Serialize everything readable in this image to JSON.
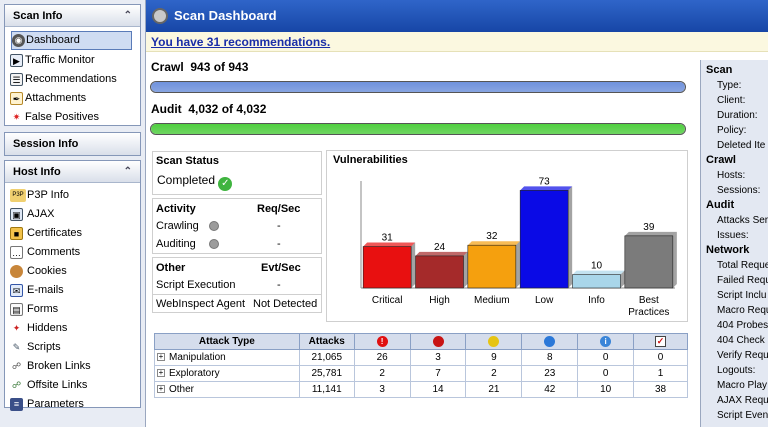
{
  "sidebar": {
    "scan_info": {
      "title": "Scan Info",
      "items": [
        {
          "label": "Dashboard",
          "icon": "dashboard-icon"
        },
        {
          "label": "Traffic Monitor",
          "icon": "traffic-monitor-icon"
        },
        {
          "label": "Recommendations",
          "icon": "recommendations-icon"
        },
        {
          "label": "Attachments",
          "icon": "attachments-icon"
        },
        {
          "label": "False Positives",
          "icon": "false-positives-icon"
        }
      ]
    },
    "session_info": {
      "title": "Session Info"
    },
    "host_info": {
      "title": "Host Info",
      "items": [
        {
          "label": "P3P Info",
          "icon": "p3p-icon"
        },
        {
          "label": "AJAX",
          "icon": "ajax-icon"
        },
        {
          "label": "Certificates",
          "icon": "certificates-icon"
        },
        {
          "label": "Comments",
          "icon": "comments-icon"
        },
        {
          "label": "Cookies",
          "icon": "cookies-icon"
        },
        {
          "label": "E-mails",
          "icon": "emails-icon"
        },
        {
          "label": "Forms",
          "icon": "forms-icon"
        },
        {
          "label": "Hiddens",
          "icon": "hiddens-icon"
        },
        {
          "label": "Scripts",
          "icon": "scripts-icon"
        },
        {
          "label": "Broken Links",
          "icon": "broken-links-icon"
        },
        {
          "label": "Offsite Links",
          "icon": "offsite-links-icon"
        },
        {
          "label": "Parameters",
          "icon": "parameters-icon"
        }
      ]
    }
  },
  "main": {
    "title": "Scan Dashboard",
    "recommendations": "You have 31 recommendations.",
    "crawl": {
      "label": "Crawl",
      "value": "943 of 943",
      "progress": 1.0,
      "color": "#6f92dd"
    },
    "audit": {
      "label": "Audit",
      "value": "4,032 of 4,032",
      "progress": 1.0,
      "color": "#4fcf3f"
    },
    "scan_status": {
      "title": "Scan Status",
      "value": "Completed"
    },
    "activity": {
      "title": "Activity",
      "unit": "Req/Sec",
      "rows": [
        {
          "label": "Crawling",
          "value": "-"
        },
        {
          "label": "Auditing",
          "value": "-"
        }
      ]
    },
    "other": {
      "title": "Other",
      "unit": "Evt/Sec",
      "rows": [
        {
          "label": "Script Execution",
          "value": "-"
        }
      ]
    },
    "webinspect_agent": {
      "label": "WebInspect Agent",
      "value": "Not Detected"
    },
    "attack_table": {
      "headers": [
        "Attack Type",
        "Attacks"
      ],
      "severity_columns": [
        "critical",
        "high",
        "medium",
        "low",
        "info",
        "best-practices"
      ],
      "severity_colors": [
        "#e01010",
        "#c81414",
        "#e6c414",
        "#2b78d8",
        "#3a85d8",
        "#ffffff"
      ],
      "rows": [
        {
          "type": "Manipulation",
          "attacks": "21,065",
          "counts": [
            "26",
            "3",
            "9",
            "8",
            "0",
            "0"
          ]
        },
        {
          "type": "Exploratory",
          "attacks": "25,781",
          "counts": [
            "2",
            "7",
            "2",
            "23",
            "0",
            "1"
          ]
        },
        {
          "type": "Other",
          "attacks": "11,141",
          "counts": [
            "3",
            "14",
            "21",
            "42",
            "10",
            "38"
          ]
        }
      ]
    }
  },
  "chart_data": {
    "type": "bar",
    "title": "Vulnerabilities",
    "categories": [
      "Critical",
      "High",
      "Medium",
      "Low",
      "Info",
      "Best Practices"
    ],
    "values": [
      31,
      24,
      32,
      73,
      10,
      39
    ],
    "colors": [
      "#e81010",
      "#a52a2a",
      "#f5a00e",
      "#0a0ae6",
      "#a9d6ea",
      "#7b7b7b"
    ],
    "ylim": [
      0,
      80
    ],
    "grid": false
  },
  "right_panel": {
    "sections": [
      {
        "title": "Scan",
        "items": [
          "Type:",
          "Client:",
          "Duration:",
          "Policy:",
          "Deleted Ite"
        ]
      },
      {
        "title": "Crawl",
        "items": [
          "Hosts:",
          "Sessions:"
        ]
      },
      {
        "title": "Audit",
        "items": [
          "Attacks Ser",
          "Issues:"
        ]
      },
      {
        "title": "Network",
        "items": [
          "Total Reque",
          "Failed Requ",
          "Script Inclu",
          "Macro Requ",
          "404 Probes",
          "404 Check R",
          "Verify Requ",
          "Logouts:",
          "Macro Play",
          "AJAX Reque",
          "Script Even"
        ]
      }
    ]
  }
}
